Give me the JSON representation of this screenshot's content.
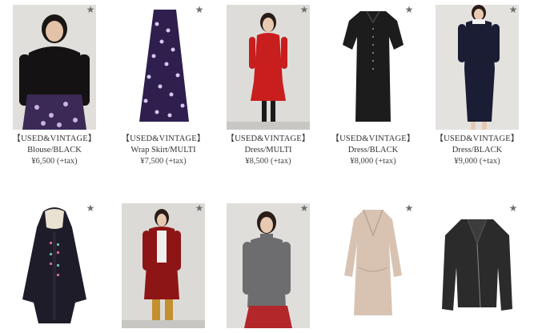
{
  "colors": {
    "background": "#ffffff",
    "text": "#333333",
    "star": "#6f6f6f"
  },
  "favorite_icon": "star-icon",
  "products": [
    {
      "category": "【USED&VINTAGE】",
      "name": "Blouse/BLACK",
      "price": "¥6,500 (+tax)"
    },
    {
      "category": "【USED&VINTAGE】",
      "name": "Wrap Skirt/MULTI",
      "price": "¥7,500 (+tax)"
    },
    {
      "category": "【USED&VINTAGE】",
      "name": "Dress/MULTI",
      "price": "¥8,500 (+tax)"
    },
    {
      "category": "【USED&VINTAGE】",
      "name": "Dress/BLACK",
      "price": "¥8,000 (+tax)"
    },
    {
      "category": "【USED&VINTAGE】",
      "name": "Dress/BLACK",
      "price": "¥9,000 (+tax)"
    },
    {
      "category": "",
      "name": "",
      "price": ""
    },
    {
      "category": "",
      "name": "",
      "price": ""
    },
    {
      "category": "",
      "name": "",
      "price": ""
    },
    {
      "category": "",
      "name": "",
      "price": ""
    },
    {
      "category": "",
      "name": "",
      "price": ""
    }
  ],
  "favorite_glyph": "★"
}
